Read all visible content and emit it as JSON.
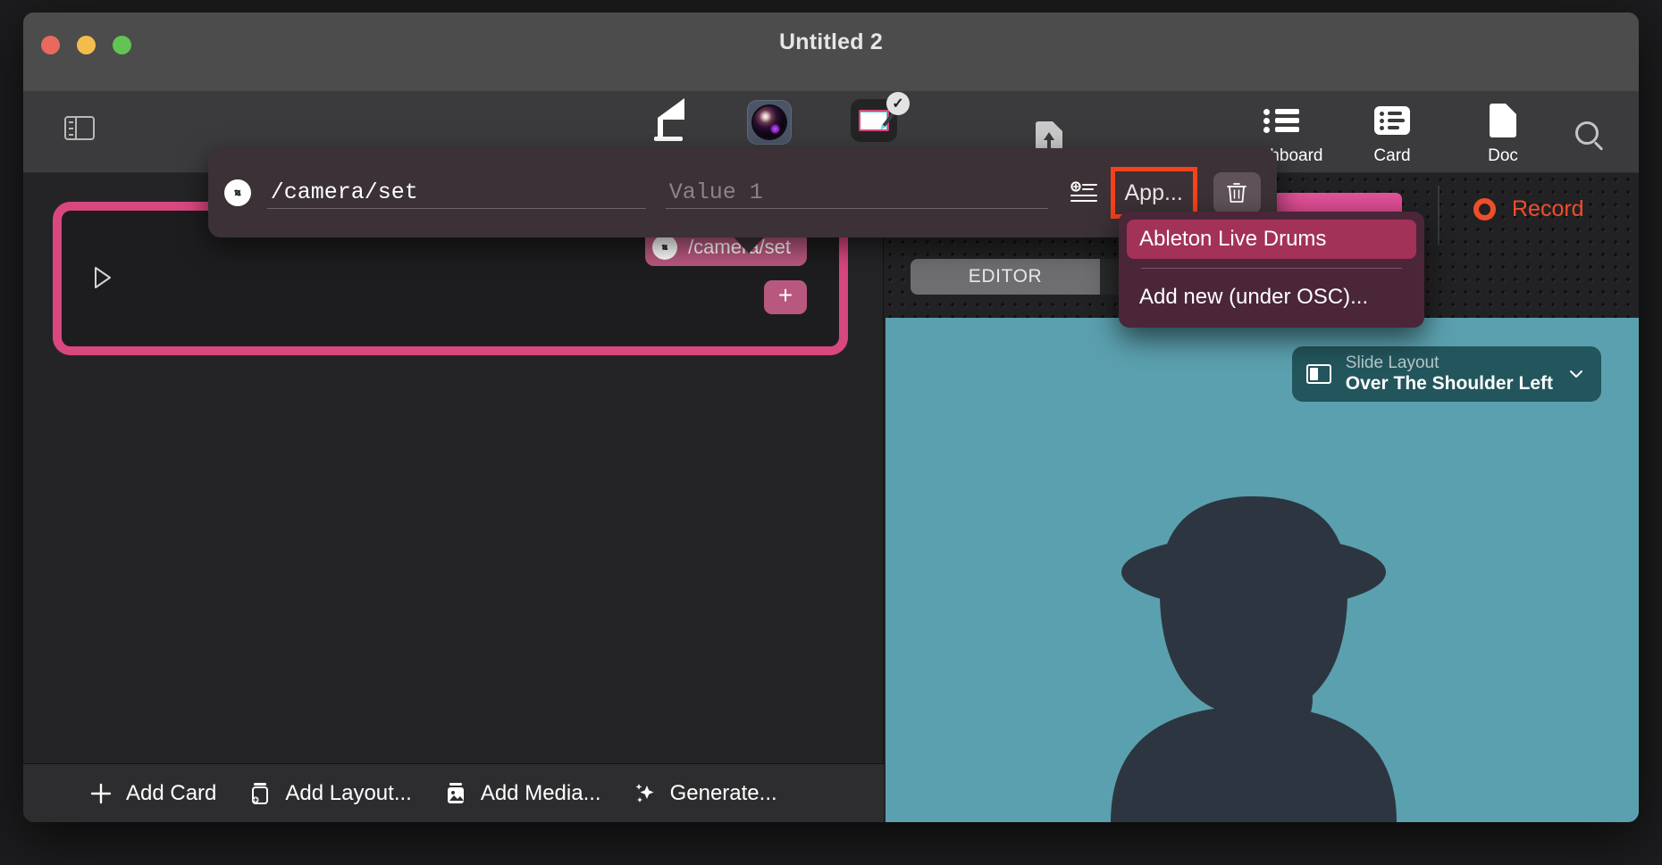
{
  "window": {
    "title": "Untitled 2",
    "traffic_lights": [
      "close",
      "minimize",
      "zoom"
    ]
  },
  "toolbar": {
    "sidebar_toggle_icon": "sidebar-toggle-icon",
    "items": [
      {
        "icon": "lamp-icon",
        "label": ""
      },
      {
        "icon": "camera-lens-icon",
        "label": ""
      },
      {
        "icon": "card-edit-icon",
        "label": "",
        "badge": "✓"
      },
      {
        "icon": "document-upload-icon",
        "label": ""
      }
    ],
    "right_items": [
      {
        "icon": "dashboard-list-icon",
        "label": "Dashboard"
      },
      {
        "icon": "card-list-icon",
        "label": "Card"
      },
      {
        "icon": "doc-page-icon",
        "label": "Doc"
      }
    ],
    "search_icon": "search-icon"
  },
  "popover": {
    "link_icon": "link-icon",
    "address_value": "/camera/set",
    "value_placeholder": "Value 1",
    "add_row_icon": "add-row-icon",
    "app_button_label": "App...",
    "trash_icon": "trash-icon",
    "highlight_color": "#f4421d"
  },
  "dropdown": {
    "items": [
      {
        "label": "Ableton Live Drums",
        "selected": true
      },
      {
        "label": "Add new (under OSC)...",
        "selected": false
      }
    ],
    "selected_color": "#a33258",
    "background_color": "#4a2638"
  },
  "left_pane": {
    "card": {
      "border_color": "#d9477f",
      "play_icon": "play-icon",
      "osc_pill": {
        "link_icon": "link-icon",
        "label": "/camera/set"
      },
      "add_button_label": "+"
    },
    "bottom_bar": [
      {
        "icon": "plus-icon",
        "label": "Add Card"
      },
      {
        "icon": "layout-stack-icon",
        "label": "Add Layout..."
      },
      {
        "icon": "media-image-icon",
        "label": "Add Media..."
      },
      {
        "icon": "sparkle-icon",
        "label": "Generate..."
      }
    ]
  },
  "right_pane": {
    "record": {
      "label": "Record",
      "icon": "record-dot-icon",
      "color": "#ef4e2a"
    },
    "tabs": [
      {
        "label": "EDITOR",
        "active": true
      },
      {
        "label": "",
        "active": false
      }
    ],
    "slide_layout": {
      "icon": "slide-layout-icon",
      "label": "Slide Layout",
      "value": "Over The Shoulder Left",
      "chevron_icon": "chevron-down-icon"
    },
    "preview": {
      "background_color": "#5ba0ae",
      "silhouette_color": "#2d3640"
    }
  }
}
